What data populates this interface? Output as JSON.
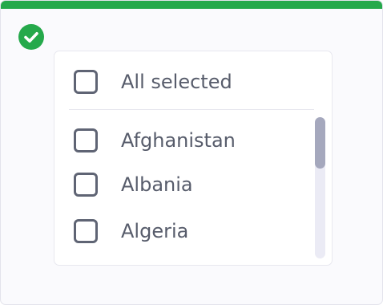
{
  "colors": {
    "accent": "#25a94b",
    "checkbox_border": "#5f6474",
    "label_text": "#575c6b",
    "scroll_thumb": "#a5a8bd",
    "scroll_track": "#ebebf5"
  },
  "status": {
    "icon": "check-circle-icon"
  },
  "multiselect": {
    "select_all": {
      "label": "All selected",
      "checked": false
    },
    "options": [
      {
        "label": "Afghanistan",
        "checked": false
      },
      {
        "label": "Albania",
        "checked": false
      },
      {
        "label": "Algeria",
        "checked": false
      }
    ],
    "scroll_position": 0
  }
}
